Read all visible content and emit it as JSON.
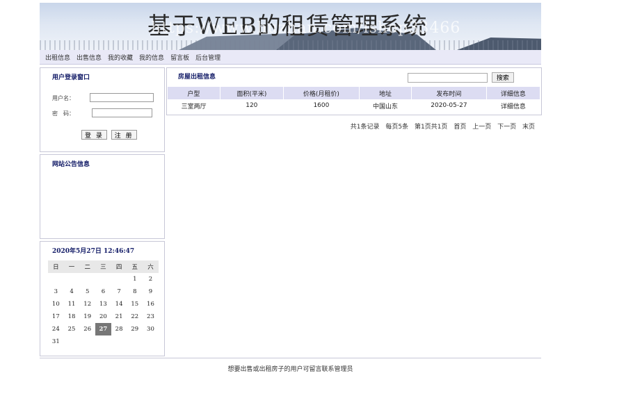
{
  "banner": {
    "title": "基于WEB的租赁管理系统",
    "watermark": "https://www.huzhan.com/ishop33466"
  },
  "nav": [
    "出租信息",
    "出售信息",
    "我的收藏",
    "我的信息",
    "留言板",
    "后台管理"
  ],
  "login": {
    "title": "用户登录窗口",
    "username_label": "用户名：",
    "password_label": "密　码：",
    "login_button": "登 录",
    "register_button": "注 册"
  },
  "notice": {
    "title": "网站公告信息"
  },
  "calendar": {
    "datetime": "2020年5月27日 12:46:47",
    "weekdays": [
      "日",
      "一",
      "二",
      "三",
      "四",
      "五",
      "六"
    ],
    "weeks": [
      [
        "",
        "",
        "",
        "",
        "",
        "1",
        "2"
      ],
      [
        "3",
        "4",
        "5",
        "6",
        "7",
        "8",
        "9"
      ],
      [
        "10",
        "11",
        "12",
        "13",
        "14",
        "15",
        "16"
      ],
      [
        "17",
        "18",
        "19",
        "20",
        "21",
        "22",
        "23"
      ],
      [
        "24",
        "25",
        "26",
        "27",
        "28",
        "29",
        "30"
      ],
      [
        "31",
        "",
        "",
        "",
        "",
        "",
        ""
      ]
    ],
    "today": "27"
  },
  "main": {
    "title": "房屋出租信息",
    "search_button": "搜索",
    "search_value": "",
    "columns": [
      "户型",
      "面积(平米)",
      "价格(月租价)",
      "地址",
      "发布时间",
      "详细信息"
    ],
    "rows": [
      [
        "三室两厅",
        "120",
        "1600",
        "中国山东",
        "2020-05-27",
        "详细信息"
      ]
    ]
  },
  "pager": {
    "total": "共1条记录",
    "per_page": "每页5条",
    "page_of": "第1页共1页",
    "first": "首页",
    "prev": "上一页",
    "next": "下一页",
    "last": "末页"
  },
  "footer": {
    "text": "想要出售或出租房子的用户可留言联系管理员"
  }
}
